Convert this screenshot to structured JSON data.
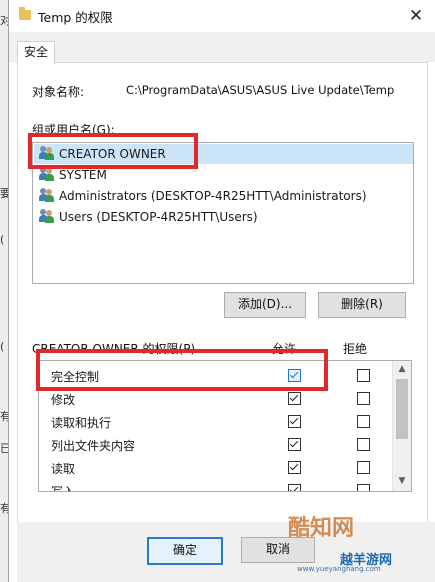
{
  "background_window": {
    "chars": [
      "对",
      "(",
      "要",
      "(",
      "有",
      "已",
      "有"
    ]
  },
  "window": {
    "title": "Temp 的权限",
    "close_glyph": "✕",
    "tab_security": "安全"
  },
  "object": {
    "label": "对象名称:",
    "value": "C:\\ProgramData\\ASUS\\ASUS Live Update\\Temp"
  },
  "groups": {
    "label": "组或用户名(G):",
    "items": [
      {
        "name": "CREATOR OWNER",
        "selected": true
      },
      {
        "name": "SYSTEM",
        "selected": false
      },
      {
        "name": "Administrators (DESKTOP-4R25HTT\\Administrators)",
        "selected": false
      },
      {
        "name": "Users (DESKTOP-4R25HTT\\Users)",
        "selected": false
      }
    ],
    "add_button": "添加(D)...",
    "remove_button": "删除(R)"
  },
  "permissions": {
    "label": "CREATOR OWNER 的权限(P)",
    "allow_header": "允许",
    "deny_header": "拒绝",
    "rows": [
      {
        "name": "完全控制",
        "allow": true,
        "deny": false
      },
      {
        "name": "修改",
        "allow": true,
        "deny": false
      },
      {
        "name": "读取和执行",
        "allow": true,
        "deny": false
      },
      {
        "name": "列出文件夹内容",
        "allow": true,
        "deny": false
      },
      {
        "name": "读取",
        "allow": true,
        "deny": false
      },
      {
        "name": "写入",
        "allow": true,
        "deny": false
      }
    ]
  },
  "footer": {
    "ok_button": "确定",
    "cancel_button": "取消"
  },
  "watermarks": {
    "cool_site": "酷知网",
    "url": "www.yueyanghang.com",
    "brand": "越羊游网"
  },
  "colors": {
    "highlight_red": "#e02a2a",
    "selection_blue": "#cce4f7"
  }
}
